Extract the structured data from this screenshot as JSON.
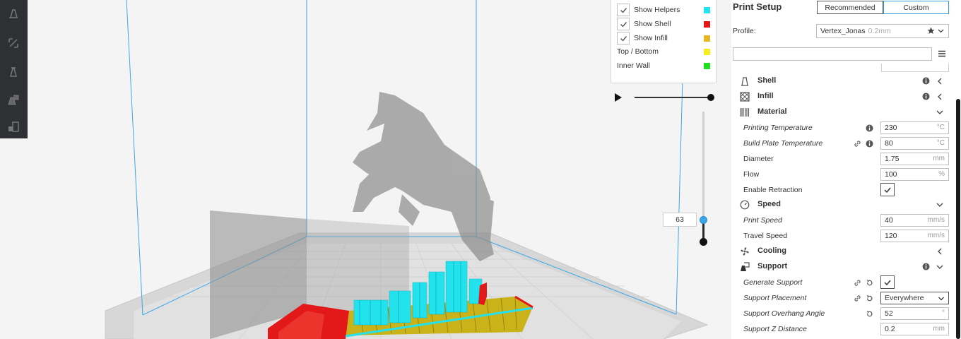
{
  "legend": {
    "rows": [
      {
        "label": "Show Helpers",
        "checked": true,
        "color": "#22e2ee"
      },
      {
        "label": "Show Shell",
        "checked": true,
        "color": "#e31818"
      },
      {
        "label": "Show Infill",
        "checked": true,
        "color": "#e6b722"
      },
      {
        "label": "Top / Bottom",
        "checked": false,
        "color": "#f6ee1c"
      },
      {
        "label": "Inner Wall",
        "checked": false,
        "color": "#1fe01f"
      }
    ]
  },
  "layer_slider": {
    "current_layer": "63"
  },
  "panel": {
    "title": "Print Setup",
    "mode_recommended": "Recommended",
    "mode_custom": "Custom",
    "profile_label": "Profile:",
    "profile_name": "Vertex_Jonas",
    "profile_suffix": "0.2mm",
    "search_placeholder": ""
  },
  "categories": {
    "shell": "Shell",
    "infill": "Infill",
    "material": "Material",
    "speed": "Speed",
    "cooling": "Cooling",
    "support": "Support"
  },
  "settings": {
    "printing_temperature": {
      "label": "Printing Temperature",
      "value": "230",
      "unit": "°C"
    },
    "build_plate_temperature": {
      "label": "Build Plate Temperature",
      "value": "80",
      "unit": "°C"
    },
    "diameter": {
      "label": "Diameter",
      "value": "1.75",
      "unit": "mm"
    },
    "flow": {
      "label": "Flow",
      "value": "100",
      "unit": "%"
    },
    "enable_retraction": {
      "label": "Enable Retraction"
    },
    "print_speed": {
      "label": "Print Speed",
      "value": "40",
      "unit": "mm/s"
    },
    "travel_speed": {
      "label": "Travel Speed",
      "value": "120",
      "unit": "mm/s"
    },
    "generate_support": {
      "label": "Generate Support"
    },
    "support_placement": {
      "label": "Support Placement",
      "value": "Everywhere"
    },
    "support_overhang_angle": {
      "label": "Support Overhang Angle",
      "value": "52",
      "unit": "°"
    },
    "support_z_distance": {
      "label": "Support Z Distance",
      "value": "0.2",
      "unit": "mm"
    }
  },
  "colors": {
    "accent": "#2fa1d8",
    "toolbar_bg": "#2e3033",
    "build_volume_lines": "#3aa8e8",
    "model_ghost": "#9a9a9a"
  }
}
